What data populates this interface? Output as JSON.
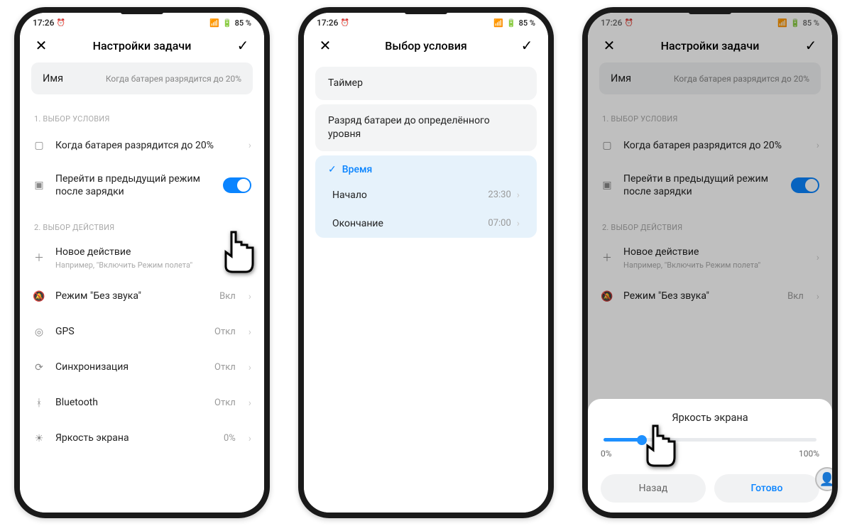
{
  "status": {
    "time": "17:26",
    "battery": "85 %"
  },
  "p1": {
    "title": "Настройки задачи",
    "name_label": "Имя",
    "name_value": "Когда батарея разрядится до 20%",
    "sec1": "1. ВЫБОР УСЛОВИЯ",
    "row_batt": "Когда батарея разрядится до 20%",
    "row_prev": "Перейти в предыдущий режим после зарядки",
    "sec2": "2. ВЫБОР ДЕЙСТВИЯ",
    "row_new": "Новое действие",
    "row_new_sub": "Например, \"Включить Режим полета\"",
    "row_silent": "Режим \"Без звука\"",
    "val_on": "Вкл",
    "row_gps": "GPS",
    "val_off": "Откл",
    "row_sync": "Синхронизация",
    "row_bt": "Bluetooth",
    "row_bright": "Яркость экрана",
    "val_0": "0%"
  },
  "p2": {
    "title": "Выбор условия",
    "opt1": "Таймер",
    "opt2": "Разряд батареи до определённого уровня",
    "opt3": "Время",
    "start_lbl": "Начало",
    "start_val": "23:30",
    "end_lbl": "Окончание",
    "end_val": "07:00"
  },
  "sheet": {
    "title": "Яркость экрана",
    "min": "0%",
    "max": "100%",
    "cancel": "Назад",
    "ok": "Готово"
  }
}
